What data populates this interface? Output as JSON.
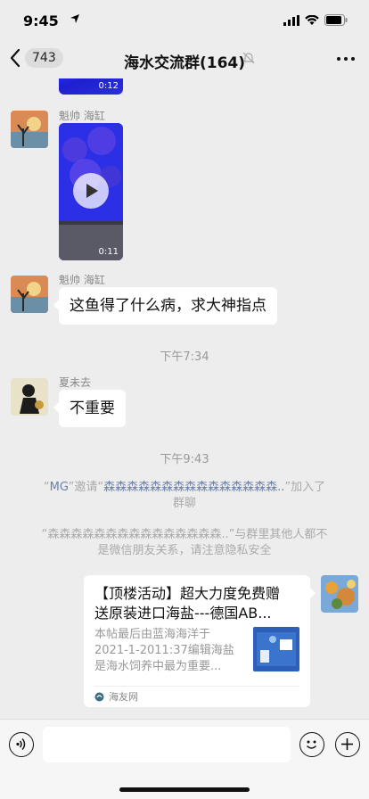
{
  "status_bar": {
    "time": "9:45"
  },
  "nav": {
    "unread_count": "743",
    "title": "海水交流群(164)"
  },
  "messages": {
    "video1": {
      "duration": "0:12"
    },
    "msg2": {
      "sender": "魁帅 海缸",
      "duration": "0:11"
    },
    "msg3": {
      "sender": "魁帅 海缸",
      "text": "这鱼得了什么病，求大神指点"
    },
    "time1": "下午7:34",
    "msg4": {
      "sender": "夏未去",
      "text": "不重要"
    },
    "time2": "下午9:43",
    "sys1": {
      "q1": "“",
      "inviter": "MG",
      "mid": "”邀请“",
      "invitee": "森森森森森森森森森森森森森森森..",
      "tail": "”加入了",
      "tail2": "群聊"
    },
    "sys2": {
      "line1": "“森森森森森森森森森森森森森森森..”与群里其他人都不",
      "line2": "是微信朋友关系，请注意隐私安全"
    },
    "card": {
      "title": "【顶楼活动】超大力度免费赠\n送原装进口海盐---德国AB...",
      "desc": "本帖最后由蓝海海洋于\n2021-1-2011:37编辑海盐\n是海水饲养中最为重要...",
      "source": "海友网"
    }
  },
  "icons": {
    "back": "chevron-left-icon",
    "mute": "bell-off-icon",
    "more": "more-icon",
    "voice": "voice-icon",
    "emoji": "emoji-icon",
    "add": "plus-icon"
  }
}
